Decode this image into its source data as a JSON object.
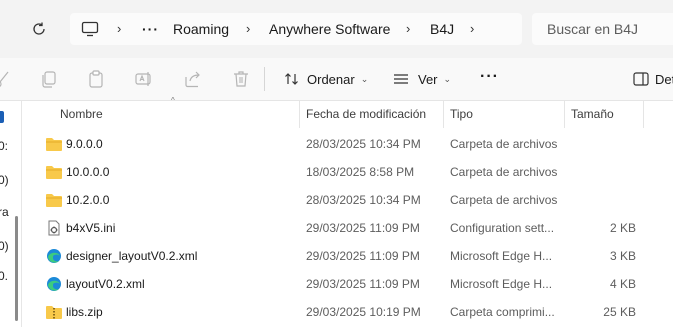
{
  "breadcrumb": {
    "items": [
      "Roaming",
      "Anywhere Software",
      "B4J"
    ],
    "ellipsis": "···"
  },
  "search": {
    "placeholder": "Buscar en B4J"
  },
  "toolbar": {
    "sort_label": "Ordenar",
    "view_label": "Ver",
    "more_label": "···",
    "details_label": "Det"
  },
  "left_pane": {
    "fragments": [
      "0:",
      "0)",
      "ra",
      "0)",
      "0."
    ]
  },
  "columns": {
    "name": "Nombre",
    "date": "Fecha de modificación",
    "type": "Tipo",
    "size": "Tamaño"
  },
  "files": [
    {
      "name": "9.0.0.0",
      "date": "28/03/2025 10:34 PM",
      "type": "Carpeta de archivos",
      "size": "",
      "icon": "folder-icon"
    },
    {
      "name": "10.0.0.0",
      "date": "18/03/2025 8:58 PM",
      "type": "Carpeta de archivos",
      "size": "",
      "icon": "folder-icon"
    },
    {
      "name": "10.2.0.0",
      "date": "28/03/2025 10:34 PM",
      "type": "Carpeta de archivos",
      "size": "",
      "icon": "folder-icon"
    },
    {
      "name": "b4xV5.ini",
      "date": "29/03/2025 11:09 PM",
      "type": "Configuration sett...",
      "size": "2 KB",
      "icon": "config-file-icon"
    },
    {
      "name": "designer_layoutV0.2.xml",
      "date": "29/03/2025 11:09 PM",
      "type": "Microsoft Edge H...",
      "size": "3 KB",
      "icon": "edge-icon"
    },
    {
      "name": "layoutV0.2.xml",
      "date": "29/03/2025 11:09 PM",
      "type": "Microsoft Edge H...",
      "size": "4 KB",
      "icon": "edge-icon"
    },
    {
      "name": "libs.zip",
      "date": "29/03/2025 10:19 PM",
      "type": "Carpeta comprimi...",
      "size": "25 KB",
      "icon": "zip-folder-icon"
    }
  ]
}
